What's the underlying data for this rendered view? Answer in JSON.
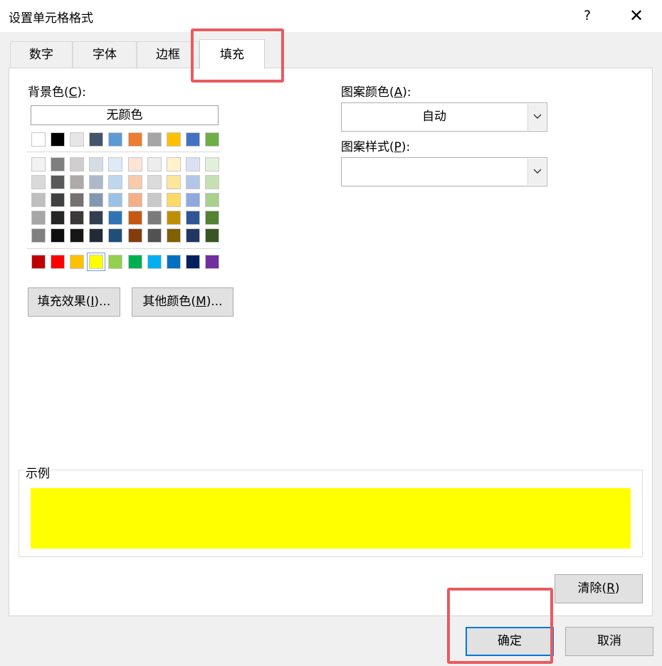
{
  "dialog": {
    "title": "设置单元格格式",
    "help_label": "?",
    "close_label": "✕"
  },
  "tabs": [
    {
      "label": "数字"
    },
    {
      "label": "字体"
    },
    {
      "label": "边框"
    },
    {
      "label": "填充",
      "active": true
    }
  ],
  "background": {
    "label": "背景色",
    "accel": "C",
    "no_color_label": "无颜色",
    "theme_row": [
      "#ffffff",
      "#000000",
      "#e7e6e6",
      "#44546a",
      "#5b9bd5",
      "#ed7d31",
      "#a5a5a5",
      "#ffc000",
      "#4472c4",
      "#70ad47"
    ],
    "tints": [
      [
        "#f2f2f2",
        "#7f7f7f",
        "#d0cece",
        "#d6dce4",
        "#ddebf7",
        "#fce4d6",
        "#ededed",
        "#fff2cc",
        "#d9e1f2",
        "#e2efda"
      ],
      [
        "#d9d9d9",
        "#595959",
        "#aeaaaa",
        "#adb9ca",
        "#bdd7ee",
        "#f8cbad",
        "#dbdbdb",
        "#ffe699",
        "#b4c6e7",
        "#c6e0b4"
      ],
      [
        "#bfbfbf",
        "#404040",
        "#757171",
        "#8497b0",
        "#9bc2e6",
        "#f4b084",
        "#c9c9c9",
        "#ffd966",
        "#8ea9db",
        "#a9d08e"
      ],
      [
        "#a6a6a6",
        "#262626",
        "#3a3838",
        "#333f4f",
        "#2f75b5",
        "#c65911",
        "#7b7b7b",
        "#bf8f00",
        "#2f5597",
        "#548235"
      ],
      [
        "#808080",
        "#0d0d0d",
        "#161616",
        "#222b35",
        "#1f4e78",
        "#833c0c",
        "#525252",
        "#806000",
        "#203764",
        "#375623"
      ]
    ],
    "standard_row": [
      "#c00000",
      "#ff0000",
      "#ffc000",
      "#ffff00",
      "#92d050",
      "#00b050",
      "#00b0f0",
      "#0070c0",
      "#002060",
      "#7030a0"
    ],
    "selected_standard_index": 3
  },
  "buttons": {
    "fill_effects_label": "填充效果",
    "fill_effects_accel": "I",
    "more_colors_label": "其他颜色",
    "more_colors_accel": "M",
    "clear_label": "清除",
    "clear_accel": "R",
    "ok_label": "确定",
    "cancel_label": "取消"
  },
  "pattern": {
    "color_label": "图案颜色",
    "color_accel": "A",
    "color_value": "自动",
    "style_label": "图案样式",
    "style_accel": "P",
    "style_value": ""
  },
  "sample": {
    "label": "示例",
    "color": "#ffff00"
  },
  "colors": {
    "highlight": "#ea5a5f",
    "accent": "#0078d7"
  }
}
